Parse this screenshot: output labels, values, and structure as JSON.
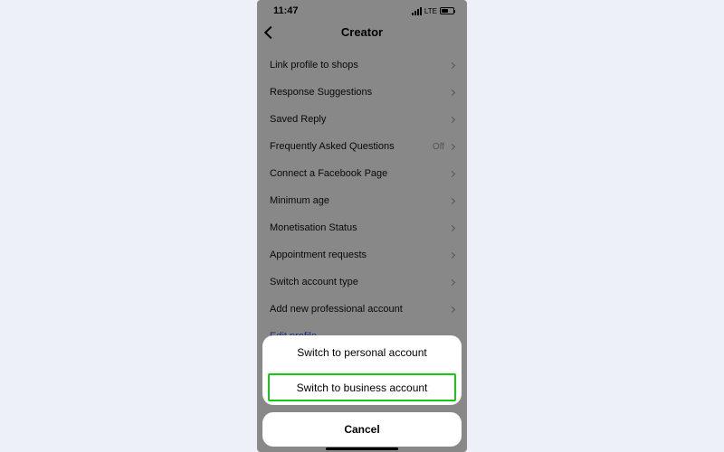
{
  "status": {
    "time": "11:47",
    "network": "LTE",
    "battery_label": "62"
  },
  "header": {
    "title": "Creator"
  },
  "rows": [
    {
      "label": "Link profile to shops",
      "trail": ""
    },
    {
      "label": "Response Suggestions",
      "trail": ""
    },
    {
      "label": "Saved Reply",
      "trail": ""
    },
    {
      "label": "Frequently Asked Questions",
      "trail": "Off"
    },
    {
      "label": "Connect a Facebook Page",
      "trail": ""
    },
    {
      "label": "Minimum age",
      "trail": ""
    },
    {
      "label": "Monetisation Status",
      "trail": ""
    },
    {
      "label": "Appointment requests",
      "trail": ""
    },
    {
      "label": "Switch account type",
      "trail": ""
    },
    {
      "label": "Add new professional account",
      "trail": ""
    }
  ],
  "link_row": {
    "label": "Edit profile"
  },
  "sheet": {
    "option_personal": "Switch to personal account",
    "option_business": "Switch to business account",
    "cancel": "Cancel"
  }
}
